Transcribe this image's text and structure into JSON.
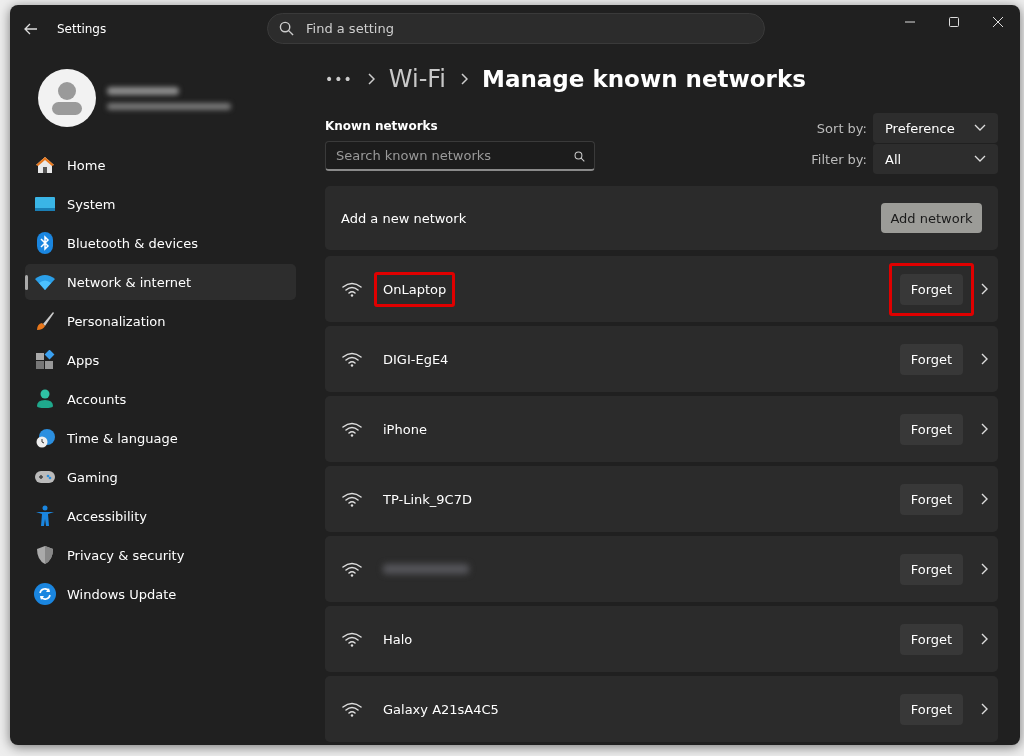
{
  "window": {
    "title": "Settings",
    "search_placeholder": "Find a setting"
  },
  "account": {
    "name_blurred": true
  },
  "sidebar": {
    "items": [
      {
        "label": "Home",
        "kind": "home",
        "selected": false
      },
      {
        "label": "System",
        "kind": "system",
        "selected": false
      },
      {
        "label": "Bluetooth & devices",
        "kind": "bluetooth",
        "selected": false
      },
      {
        "label": "Network & internet",
        "kind": "wifi",
        "selected": true
      },
      {
        "label": "Personalization",
        "kind": "brush",
        "selected": false
      },
      {
        "label": "Apps",
        "kind": "apps",
        "selected": false
      },
      {
        "label": "Accounts",
        "kind": "person",
        "selected": false
      },
      {
        "label": "Time & language",
        "kind": "time",
        "selected": false
      },
      {
        "label": "Gaming",
        "kind": "gamepad",
        "selected": false
      },
      {
        "label": "Accessibility",
        "kind": "access",
        "selected": false
      },
      {
        "label": "Privacy & security",
        "kind": "shield",
        "selected": false
      },
      {
        "label": "Windows Update",
        "kind": "update",
        "selected": false
      }
    ]
  },
  "breadcrumb": {
    "more": "•••",
    "parent": "Wi-Fi",
    "current": "Manage known networks"
  },
  "known_networks": {
    "heading": "Known networks",
    "search_placeholder": "Search known networks",
    "sort_label": "Sort by:",
    "sort_value": "Preference",
    "filter_label": "Filter by:",
    "filter_value": "All",
    "add_label": "Add a new network",
    "add_button": "Add network"
  },
  "networks": [
    {
      "name": "OnLaptop",
      "forget": "Forget",
      "highlighted": true
    },
    {
      "name": "DIGI-EgE4",
      "forget": "Forget",
      "highlighted": false
    },
    {
      "name": "iPhone",
      "forget": "Forget",
      "highlighted": false
    },
    {
      "name": "TP-Link_9C7D",
      "forget": "Forget",
      "highlighted": false
    },
    {
      "kind": "blurred",
      "forget": "Forget",
      "highlighted": false
    },
    {
      "name": "Halo",
      "forget": "Forget",
      "highlighted": false
    },
    {
      "name": "Galaxy A21sA4C5",
      "forget": "Forget",
      "highlighted": false
    }
  ]
}
